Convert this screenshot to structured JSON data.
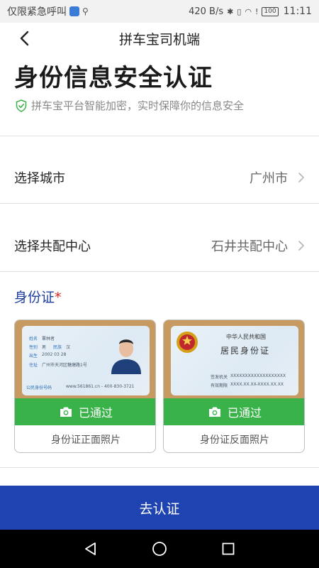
{
  "status_bar": {
    "carrier": "仅限紧急呼叫",
    "net_speed": "420 B/s",
    "battery": "100",
    "time": "11:11"
  },
  "nav": {
    "title": "拼车宝司机端",
    "back_icon": "chevron-left-icon"
  },
  "page": {
    "title": "身份信息安全认证",
    "subtitle": "拼车宝平台智能加密，实时保障你的信息安全",
    "subtitle_icon": "shield-check-icon"
  },
  "city_row": {
    "label": "选择城市",
    "value": "广州市"
  },
  "center_row": {
    "label": "选择共配中心",
    "value": "石井共配中心"
  },
  "id_section": {
    "title": "身份证",
    "required_mark": "*",
    "front": {
      "status": "已通过",
      "caption": "身份证正面照片",
      "card_text": {
        "name_label": "姓名",
        "name": "覃林者",
        "sex_label": "性别",
        "sex": "男",
        "ethnic_label": "民族",
        "ethnic": "汉",
        "birth_label": "出生",
        "birth": "2002  03  28",
        "addr_label": "住址",
        "addr": "广州市天河区糖塘路1号",
        "id_label": "公民身份号码",
        "watermark": "www.561861.cn - 400-830-3721"
      }
    },
    "back": {
      "status": "已通过",
      "caption": "身份证反面照片",
      "card_text": {
        "country": "中华人民共和国",
        "card_name": "居民身份证",
        "authority_label": "签发机关",
        "authority": "XXXXXXXXXXXXXXXXXXX",
        "valid_label": "有效期限",
        "valid": "XXXX.XX.XX-XXXX.XX.XX"
      }
    }
  },
  "submit": {
    "label": "去认证"
  },
  "colors": {
    "accent": "#1f44b2",
    "success": "#3ab24a",
    "section_title": "#1e3fa0",
    "required": "#e02020"
  }
}
